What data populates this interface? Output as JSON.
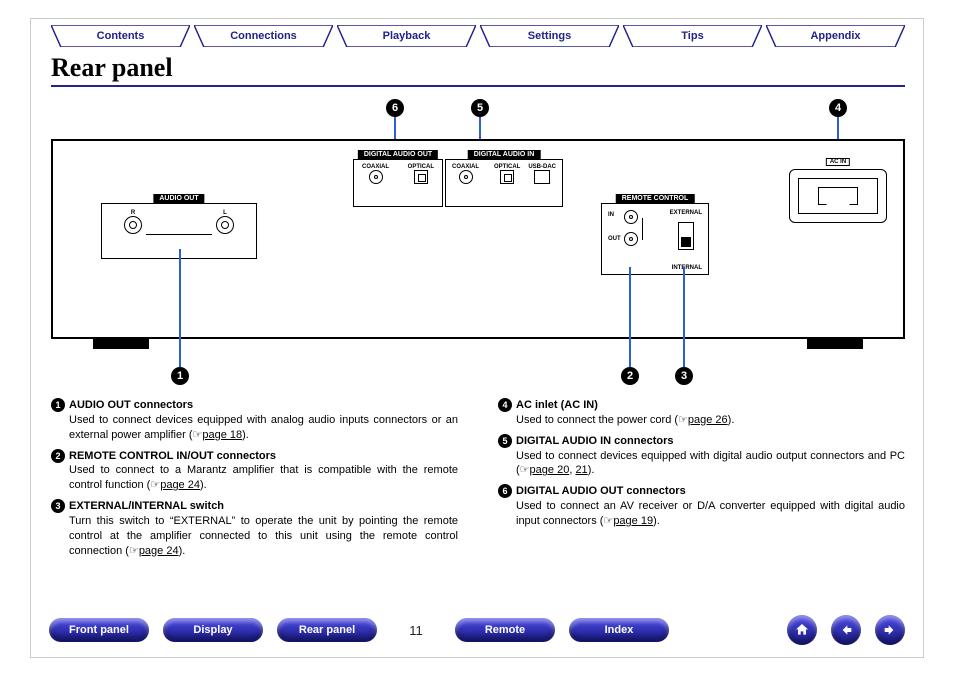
{
  "top_tabs": [
    "Contents",
    "Connections",
    "Playback",
    "Settings",
    "Tips",
    "Appendix"
  ],
  "title": "Rear panel",
  "diagram": {
    "audio_out": {
      "title": "AUDIO OUT",
      "left": "R",
      "right": "L"
    },
    "digital_out": {
      "title": "DIGITAL AUDIO OUT",
      "coax": "COAXIAL",
      "opt": "OPTICAL"
    },
    "digital_in": {
      "title": "DIGITAL AUDIO IN",
      "coax": "COAXIAL",
      "opt": "OPTICAL",
      "usb": "USB-DAC"
    },
    "remote": {
      "title": "REMOTE CONTROL",
      "in": "IN",
      "out": "OUT",
      "ext": "EXTERNAL",
      "int": "INTERNAL"
    },
    "ac": {
      "title": "AC IN"
    },
    "callouts": {
      "c1": "1",
      "c2": "2",
      "c3": "3",
      "c4": "4",
      "c5": "5",
      "c6": "6"
    }
  },
  "items": {
    "i1": {
      "num": "1",
      "title": "AUDIO OUT connectors",
      "body": "Used to connect devices equipped with analog audio inputs connectors or an external power amplifier (",
      "link": "page 18",
      "tail": ")."
    },
    "i2": {
      "num": "2",
      "title": "REMOTE CONTROL IN/OUT connectors",
      "body": "Used to connect to a Marantz amplifier that is compatible with the remote control function (",
      "link": "page 24",
      "tail": ")."
    },
    "i3": {
      "num": "3",
      "title": "EXTERNAL/INTERNAL switch",
      "body": "Turn this switch to “EXTERNAL” to operate the unit by pointing the remote control at the amplifier connected to this unit using the remote control connection (",
      "link": "page 24",
      "tail": ")."
    },
    "i4": {
      "num": "4",
      "title": "AC inlet (AC IN)",
      "body": "Used to connect the power cord (",
      "link": "page 26",
      "tail": ")."
    },
    "i5": {
      "num": "5",
      "title": "DIGITAL AUDIO IN connectors",
      "body": "Used to connect devices equipped with digital audio output connectors and PC (",
      "link1": "page 20",
      "sep": ", ",
      "link2": "21",
      "tail": ")."
    },
    "i6": {
      "num": "6",
      "title": "DIGITAL AUDIO OUT connectors",
      "body": "Used to connect an AV receiver or D/A converter equipped with digital audio input connectors (",
      "link": "page 19",
      "tail": ")."
    }
  },
  "footer": {
    "front": "Front panel",
    "display": "Display",
    "rear": "Rear panel",
    "remote": "Remote",
    "index": "Index",
    "page": "11"
  }
}
